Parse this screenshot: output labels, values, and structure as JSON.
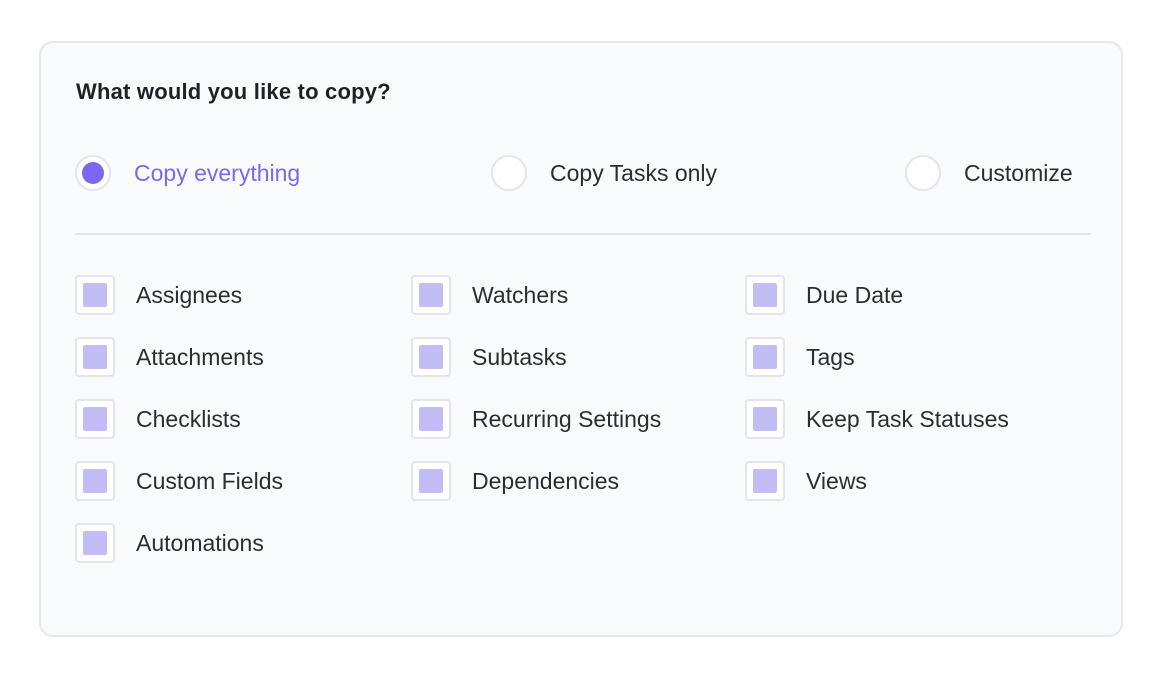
{
  "title": "What would you like to copy?",
  "accent_color": "#7b68ee",
  "checkbox_fill_color": "#c3bdf5",
  "copy_mode": {
    "selected": "Copy everything",
    "options": [
      {
        "label": "Copy everything",
        "selected": true
      },
      {
        "label": "Copy Tasks only",
        "selected": false
      },
      {
        "label": "Customize",
        "selected": false
      }
    ]
  },
  "items": {
    "col1": [
      {
        "label": "Assignees",
        "checked": true
      },
      {
        "label": "Attachments",
        "checked": true
      },
      {
        "label": "Checklists",
        "checked": true
      },
      {
        "label": "Custom Fields",
        "checked": true
      },
      {
        "label": "Automations",
        "checked": true
      }
    ],
    "col2": [
      {
        "label": "Watchers",
        "checked": true
      },
      {
        "label": "Subtasks",
        "checked": true
      },
      {
        "label": "Recurring Settings",
        "checked": true
      },
      {
        "label": "Dependencies",
        "checked": true
      }
    ],
    "col3": [
      {
        "label": "Due Date",
        "checked": true
      },
      {
        "label": "Tags",
        "checked": true
      },
      {
        "label": "Keep Task Statuses",
        "checked": true
      },
      {
        "label": "Views",
        "checked": true
      }
    ]
  }
}
